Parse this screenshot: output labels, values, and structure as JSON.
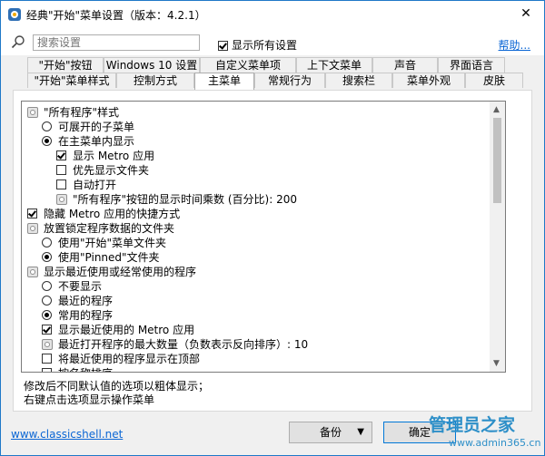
{
  "window": {
    "title": "经典\"开始\"菜单设置（版本：4.2.1）",
    "close_glyph": "✕"
  },
  "toolbar": {
    "search_placeholder": "搜索设置",
    "show_all_label": "显示所有设置",
    "show_all_checked": true,
    "help_label": "帮助..."
  },
  "tabs": {
    "row1": [
      "\"开始\"按钮",
      "Windows 10 设置",
      "自定义菜单项",
      "上下文菜单",
      "声音",
      "界面语言"
    ],
    "row2": [
      "\"开始\"菜单样式",
      "控制方式",
      "主菜单",
      "常规行为",
      "搜索栏",
      "菜单外观",
      "皮肤"
    ],
    "active": "主菜单"
  },
  "tree": {
    "items": [
      {
        "kind": "gear",
        "label": "\"所有程序\"样式"
      },
      {
        "kind": "radio",
        "checked": false,
        "label": "可展开的子菜单"
      },
      {
        "kind": "radio",
        "checked": true,
        "label": "在主菜单内显示"
      },
      {
        "kind": "checkbox",
        "checked": true,
        "label": "显示 Metro 应用"
      },
      {
        "kind": "checkbox",
        "checked": false,
        "label": "优先显示文件夹"
      },
      {
        "kind": "checkbox",
        "checked": false,
        "label": "自动打开"
      },
      {
        "kind": "gear",
        "label": "\"所有程序\"按钮的显示时间乘数 (百分比): 200"
      },
      {
        "kind": "checkbox",
        "checked": true,
        "label": "隐藏 Metro 应用的快捷方式"
      },
      {
        "kind": "gear",
        "label": "放置锁定程序数据的文件夹"
      },
      {
        "kind": "radio",
        "checked": false,
        "label": "使用\"开始\"菜单文件夹"
      },
      {
        "kind": "radio",
        "checked": true,
        "label": "使用\"Pinned\"文件夹"
      },
      {
        "kind": "gear",
        "label": "显示最近使用或经常使用的程序"
      },
      {
        "kind": "radio",
        "checked": false,
        "label": "不要显示"
      },
      {
        "kind": "radio",
        "checked": false,
        "label": "最近的程序"
      },
      {
        "kind": "radio",
        "checked": true,
        "label": "常用的程序"
      },
      {
        "kind": "checkbox",
        "checked": true,
        "label": "显示最近使用的 Metro 应用"
      },
      {
        "kind": "gear",
        "label": "最近打开程序的最大数量（负数表示反向排序）: 10"
      },
      {
        "kind": "checkbox",
        "checked": false,
        "label": "将最近使用的程序显示在顶部"
      },
      {
        "kind": "checkbox",
        "checked": false,
        "label": "按名称排序"
      }
    ]
  },
  "hints": {
    "line1": "修改后不同默认值的选项以粗体显示；",
    "line2": "右键点击选项显示操作菜单"
  },
  "footer": {
    "link": "www.classicshell.net",
    "backup_label": "备份",
    "backup_arrow": "▼",
    "ok_label": "确定"
  },
  "watermark": {
    "text": "管理员之家",
    "url": "www.admin365.cn"
  }
}
